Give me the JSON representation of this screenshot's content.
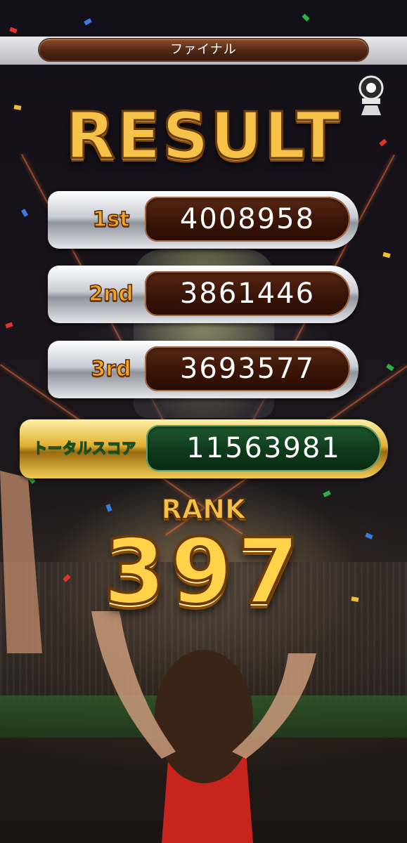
{
  "header": {
    "title": "ファイナル"
  },
  "badge": {
    "icon": "trophy-emblem-icon"
  },
  "result": {
    "title": "RESULT"
  },
  "scores": [
    {
      "label": "1st",
      "value": "4008958"
    },
    {
      "label": "2nd",
      "value": "3861446"
    },
    {
      "label": "3rd",
      "value": "3693577"
    }
  ],
  "total": {
    "label": "トータルスコア",
    "value": "11563981"
  },
  "rank": {
    "label": "RANK",
    "value": "397"
  },
  "colors": {
    "gold": "#f6c24a",
    "score_bg": "#3a1408",
    "total_bg": "#0f3a1c",
    "header_bg": "#4a2412"
  }
}
